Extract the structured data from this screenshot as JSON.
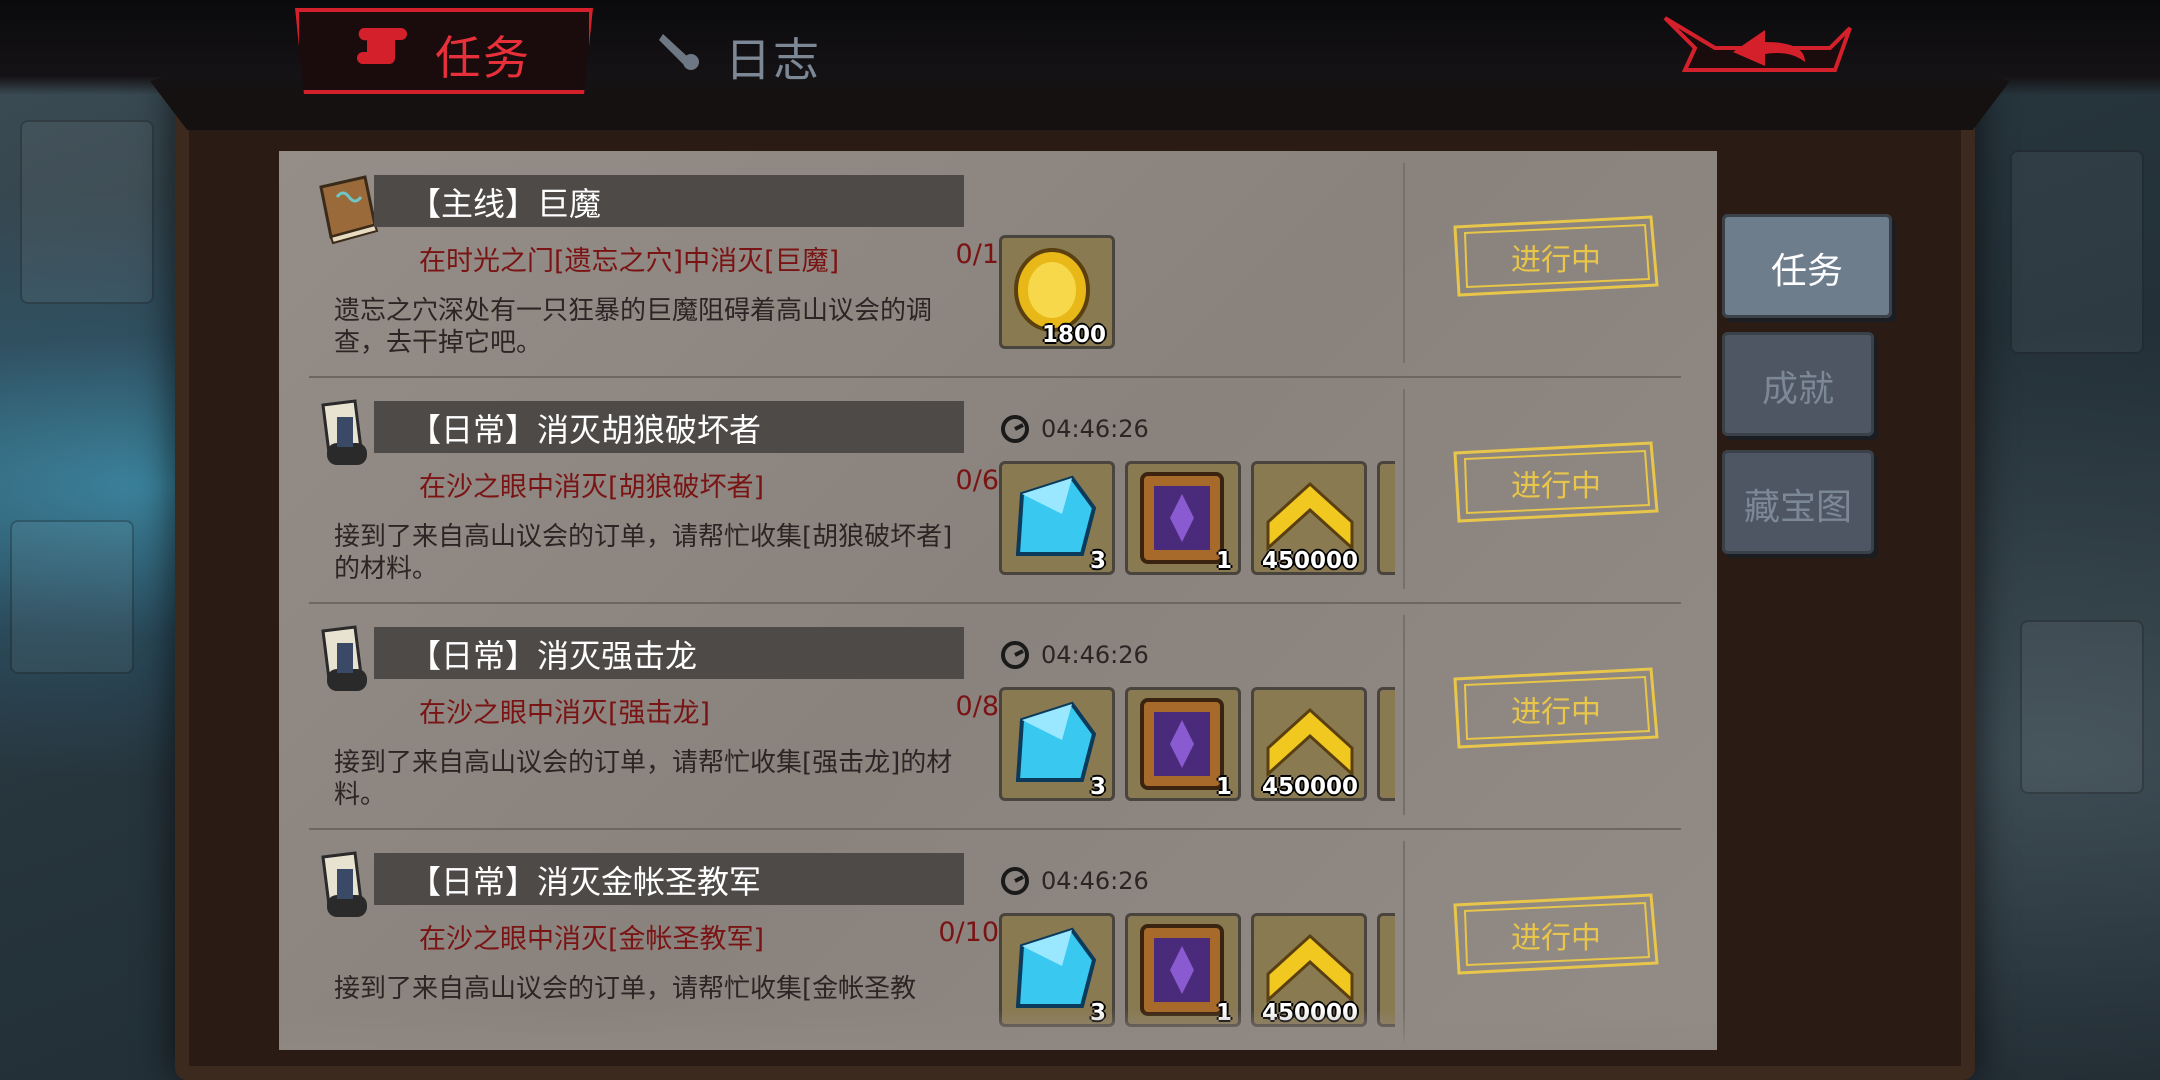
{
  "tabs": {
    "active": "任务",
    "inactive": "日志"
  },
  "side_tabs": [
    {
      "label": "任务",
      "active": true
    },
    {
      "label": "成就",
      "active": false
    },
    {
      "label": "藏宝图",
      "active": false
    }
  ],
  "quests": [
    {
      "title": "【主线】巨魔",
      "icon": "book-icon",
      "objective": "在时光之门[遗忘之穴]中消灭[巨魔]",
      "progress": "0/1",
      "description": "遗忘之穴深处有一只狂暴的巨魔阻碍着高山议会的调查，去干掉它吧。",
      "timer": "",
      "rewards": [
        {
          "icon": "gold-coin-icon",
          "count": "1800"
        }
      ],
      "status": "进行中"
    },
    {
      "title": "【日常】消灭胡狼破坏者",
      "icon": "scroll-icon",
      "objective": "在沙之眼中消灭[胡狼破坏者]",
      "progress": "0/6",
      "description": "接到了来自高山议会的订单，请帮忙收集[胡狼破坏者]的材料。",
      "timer": "04:46:26",
      "rewards": [
        {
          "icon": "blue-crystal-icon",
          "count": "3"
        },
        {
          "icon": "purple-tome-icon",
          "count": "1"
        },
        {
          "icon": "gold-chevron-icon",
          "count": "450000"
        }
      ],
      "status": "进行中"
    },
    {
      "title": "【日常】消灭强击龙",
      "icon": "scroll-icon",
      "objective": "在沙之眼中消灭[强击龙]",
      "progress": "0/8",
      "description": "接到了来自高山议会的订单，请帮忙收集[强击龙]的材料。",
      "timer": "04:46:26",
      "rewards": [
        {
          "icon": "blue-crystal-icon",
          "count": "3"
        },
        {
          "icon": "purple-tome-icon",
          "count": "1"
        },
        {
          "icon": "gold-chevron-icon",
          "count": "450000"
        }
      ],
      "status": "进行中"
    },
    {
      "title": "【日常】消灭金帐圣教军",
      "icon": "scroll-icon",
      "objective": "在沙之眼中消灭[金帐圣教军]",
      "progress": "0/10",
      "description": "接到了来自高山议会的订单，请帮忙收集[金帐圣教",
      "timer": "04:46:26",
      "rewards": [
        {
          "icon": "blue-crystal-icon",
          "count": "3"
        },
        {
          "icon": "purple-tome-icon",
          "count": "1"
        },
        {
          "icon": "gold-chevron-icon",
          "count": "450000"
        }
      ],
      "status": "进行中"
    }
  ],
  "colors": {
    "accent_red": "#d4202a",
    "objective_red": "#7a1414",
    "gold": "#e8c64a"
  }
}
